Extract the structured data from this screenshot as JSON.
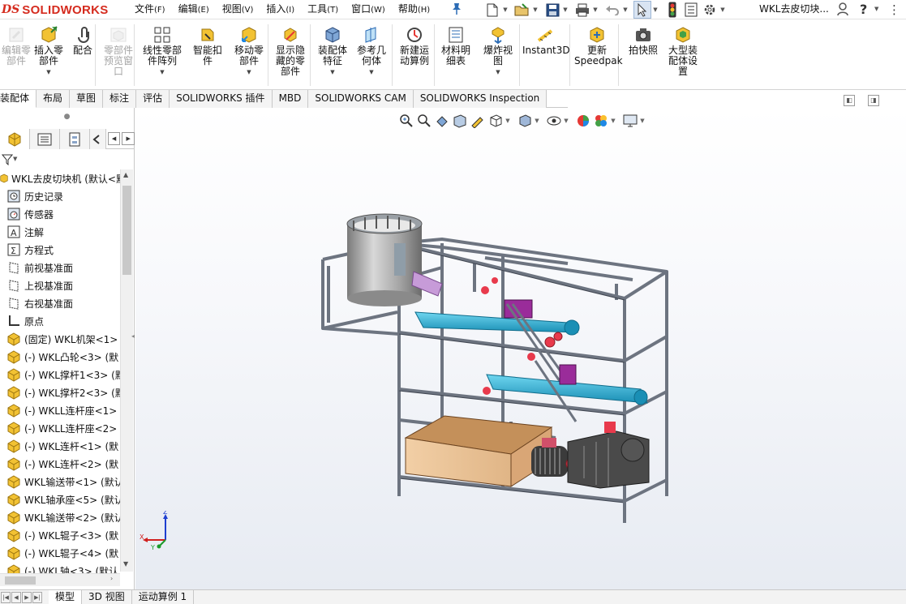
{
  "app": {
    "logo_ds": "DS",
    "logo_brand": "SOLIDWORKS",
    "document_title": "WKL去皮切块...",
    "colors": {
      "brand": "#d52b1e",
      "accent": "#2c6cb5"
    }
  },
  "menu": [
    {
      "label": "文件",
      "key": "(F)"
    },
    {
      "label": "编辑",
      "key": "(E)"
    },
    {
      "label": "视图",
      "key": "(V)"
    },
    {
      "label": "插入",
      "key": "(I)"
    },
    {
      "label": "工具",
      "key": "(T)"
    },
    {
      "label": "窗口",
      "key": "(W)"
    },
    {
      "label": "帮助",
      "key": "(H)"
    }
  ],
  "quickbar": [
    "new-document-icon",
    "open-icon",
    "save-icon",
    "print-icon",
    "undo-icon",
    "select-icon",
    "rebuild-icon",
    "file-properties-icon",
    "options-icon"
  ],
  "ribbon": [
    {
      "l1": "编辑零",
      "l2": "部件",
      "disabled": true
    },
    {
      "l1": "插入零",
      "l2": "部件",
      "drop": true
    },
    {
      "l1": "配合",
      "l2": ""
    },
    {
      "l1": "零部件",
      "l2": "预览窗",
      "l3": "口",
      "disabled": true
    },
    {
      "l1": "线性零部",
      "l2": "件阵列",
      "drop": true
    },
    {
      "l1": "智能扣",
      "l2": "件"
    },
    {
      "l1": "移动零",
      "l2": "部件",
      "drop": true
    },
    {
      "l1": "显示隐",
      "l2": "藏的零",
      "l3": "部件"
    },
    {
      "l1": "装配体",
      "l2": "特征",
      "drop": true
    },
    {
      "l1": "参考几",
      "l2": "何体",
      "drop": true
    },
    {
      "l1": "新建运",
      "l2": "动算例"
    },
    {
      "l1": "材料明",
      "l2": "细表"
    },
    {
      "l1": "爆炸视",
      "l2": "图",
      "drop": true
    },
    {
      "l1": "Instant3D",
      "l2": ""
    },
    {
      "l1": "更新",
      "l2": "Speedpak"
    },
    {
      "l1": "拍快照",
      "l2": ""
    },
    {
      "l1": "大型装",
      "l2": "配体设",
      "l3": "置"
    }
  ],
  "tabs": [
    "装配体",
    "布局",
    "草图",
    "标注",
    "评估",
    "SOLIDWORKS 插件",
    "MBD",
    "SOLIDWORKS CAM",
    "SOLIDWORKS Inspection"
  ],
  "tree": {
    "root": "WKL去皮切块机  (默认<默",
    "items": [
      {
        "icon": "history-icon",
        "label": "历史记录"
      },
      {
        "icon": "sensor-icon",
        "label": "传感器"
      },
      {
        "icon": "annotation-icon",
        "label": "注解"
      },
      {
        "icon": "equation-icon",
        "label": "方程式"
      },
      {
        "icon": "plane-icon",
        "label": "前视基准面"
      },
      {
        "icon": "plane-icon",
        "label": "上视基准面"
      },
      {
        "icon": "plane-icon",
        "label": "右视基准面"
      },
      {
        "icon": "origin-icon",
        "label": "原点"
      },
      {
        "icon": "part-icon",
        "label": "(固定) WKL机架<1>"
      },
      {
        "icon": "part-icon",
        "label": "(-) WKL凸轮<3> (默"
      },
      {
        "icon": "part-icon",
        "label": "(-) WKL撑杆1<3> (默"
      },
      {
        "icon": "part-icon",
        "label": "(-) WKL撑杆2<3> (默"
      },
      {
        "icon": "part-icon",
        "label": "(-) WKLL连杆座<1>"
      },
      {
        "icon": "part-icon",
        "label": "(-) WKLL连杆座<2>"
      },
      {
        "icon": "part-icon",
        "label": "(-) WKL连杆<1> (默"
      },
      {
        "icon": "part-icon",
        "label": "(-) WKL连杆<2> (默"
      },
      {
        "icon": "part-icon",
        "label": "WKL输送带<1> (默认"
      },
      {
        "icon": "part-icon",
        "label": "WKL轴承座<5> (默认"
      },
      {
        "icon": "part-icon",
        "label": "WKL输送带<2> (默认"
      },
      {
        "icon": "part-icon",
        "label": "(-) WKL辊子<3> (默"
      },
      {
        "icon": "part-icon",
        "label": "(-) WKL辊子<4> (默"
      },
      {
        "icon": "part-icon",
        "label": "(-) WKL轴<3> (默认"
      }
    ]
  },
  "triad": {
    "z": "Z",
    "x": "X",
    "y": "Y"
  },
  "bottom_tabs": [
    "模型",
    "3D 视图",
    "运动算例 1"
  ]
}
